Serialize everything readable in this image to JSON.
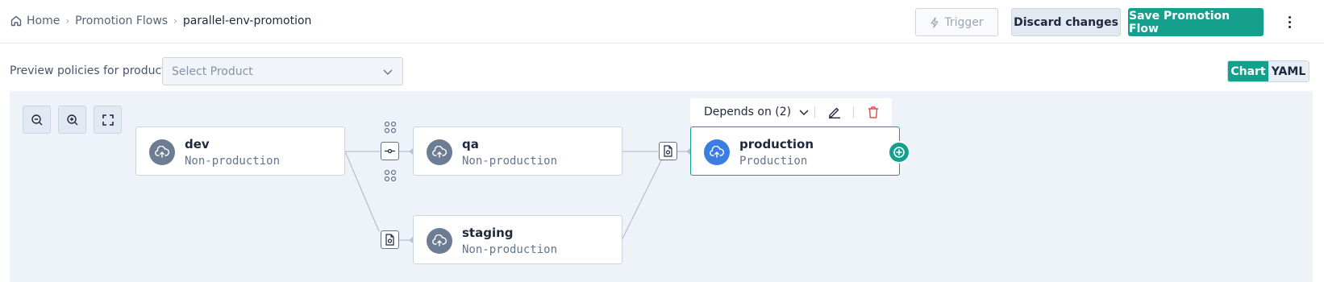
{
  "breadcrumb": {
    "home": "Home",
    "flows": "Promotion Flows",
    "current": "parallel-env-promotion",
    "separator": "›"
  },
  "header": {
    "trigger_label": "Trigger",
    "discard_label": "Discard changes",
    "save_label": "Save Promotion Flow"
  },
  "preview": {
    "label": "Preview policies for product:",
    "select_placeholder": "Select Product"
  },
  "view_toggle": {
    "chart": "Chart",
    "yaml": "YAML",
    "active": "Chart"
  },
  "toolbar": {
    "depends_on": "Depends on (2)"
  },
  "nodes": [
    {
      "id": "dev",
      "title": "dev",
      "subtitle": "Non-production"
    },
    {
      "id": "qa",
      "title": "qa",
      "subtitle": "Non-production"
    },
    {
      "id": "staging",
      "title": "staging",
      "subtitle": "Non-production"
    },
    {
      "id": "production",
      "title": "production",
      "subtitle": "Production",
      "selected": true
    }
  ],
  "colors": {
    "accent": "#14a08d",
    "selected_avatar": "#3b7de0",
    "avatar": "#6b7c93",
    "danger": "#e5484d",
    "canvas_bg": "#eef2f9"
  },
  "icons": {
    "home": "home-icon",
    "trigger": "lightning-icon",
    "more": "kebab-icon",
    "zoom_out": "zoom-out-icon",
    "zoom_in": "zoom-in-icon",
    "fit": "fit-screen-icon",
    "env": "cloud-upload-icon",
    "edit": "pencil-icon",
    "delete": "trash-icon",
    "add": "plus-circle-icon"
  }
}
